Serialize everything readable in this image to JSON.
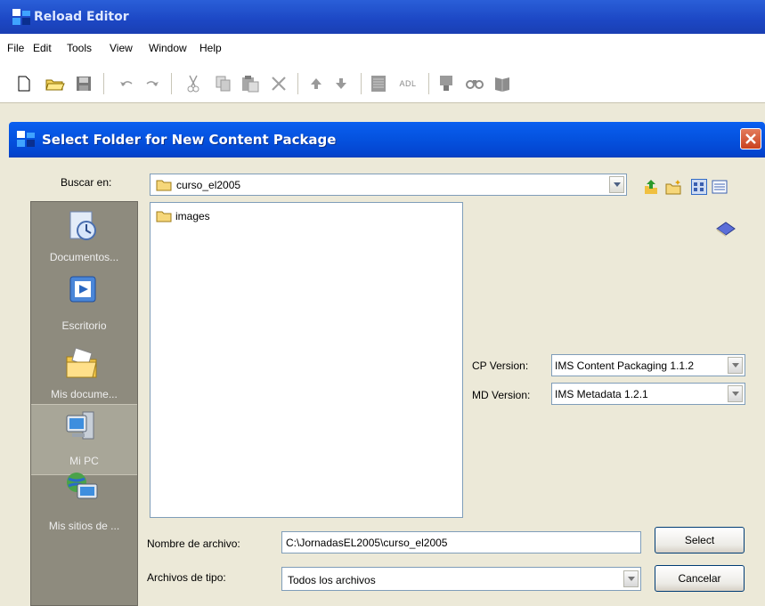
{
  "app": {
    "title": "Reload Editor"
  },
  "menu": [
    "File",
    "Edit",
    "Tools",
    "View",
    "Window",
    "Help"
  ],
  "toolbar": {
    "adl_label": "ADL"
  },
  "dialog": {
    "title": "Select Folder for New Content Package",
    "look_in_label": "Buscar en:",
    "look_in_value": "curso_el2005",
    "places": [
      {
        "label": "Documentos..."
      },
      {
        "label": "Escritorio"
      },
      {
        "label": "Mis docume..."
      },
      {
        "label": "Mi PC"
      },
      {
        "label": "Mis sitios de ..."
      }
    ],
    "files": [
      {
        "name": "images"
      }
    ],
    "cp_version_label": "CP Version:",
    "cp_version_value": "IMS Content Packaging 1.1.2",
    "md_version_label": "MD Version:",
    "md_version_value": "IMS Metadata 1.2.1",
    "filename_label": "Nombre de archivo:",
    "filename_value": "C:\\JornadasEL2005\\curso_el2005",
    "filetype_label": "Archivos de tipo:",
    "filetype_value": "Todos los archivos",
    "select_label": "Select",
    "cancel_label": "Cancelar"
  }
}
